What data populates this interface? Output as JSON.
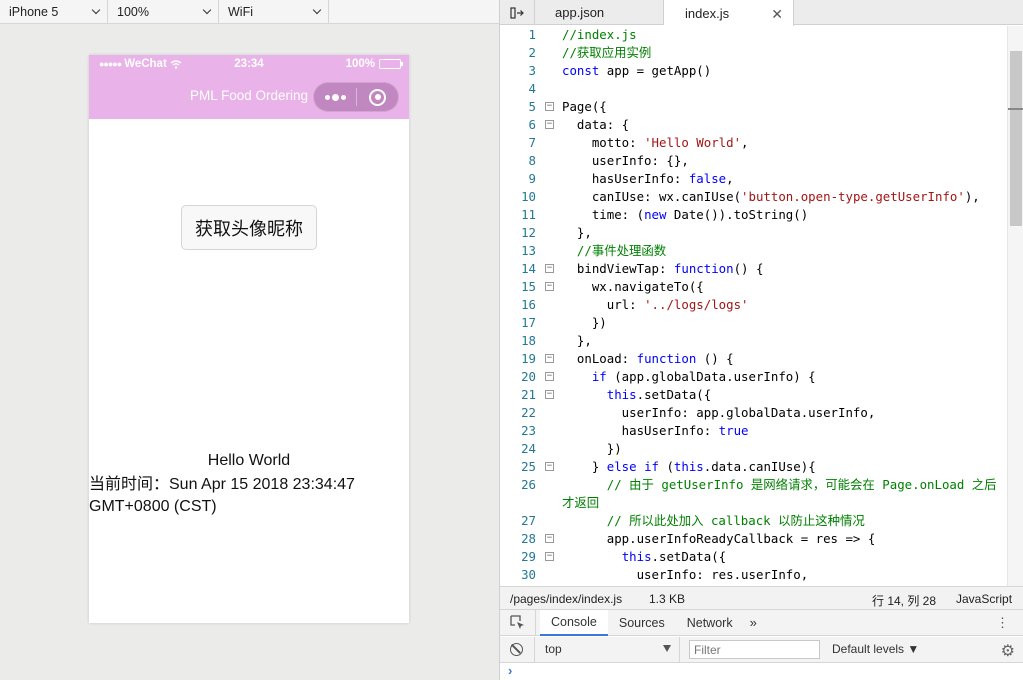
{
  "simulator": {
    "device": "iPhone 5",
    "zoom": "100%",
    "network": "WiFi",
    "status_bar": {
      "carrier": "WeChat",
      "time": "23:34",
      "battery": "100%",
      "battery_level": 1.0
    },
    "nav_title": "PML Food Ordering",
    "get_info_button": "获取头像昵称",
    "motto": "Hello World",
    "time_text": "当前时间：Sun Apr 15 2018 23:34:47 GMT+0800 (CST)",
    "header_color": "#e9b2e8"
  },
  "editor": {
    "tabs": [
      {
        "label": "app.json",
        "active": false
      },
      {
        "label": "index.js",
        "active": true
      }
    ],
    "code_lines": [
      {
        "n": "1",
        "text": "//index.js"
      },
      {
        "n": "2",
        "text": "//获取应用实例"
      },
      {
        "n": "3",
        "text": "const app = getApp()"
      },
      {
        "n": "4",
        "text": ""
      },
      {
        "n": "5",
        "text": "Page({"
      },
      {
        "n": "6",
        "text": "  data: {"
      },
      {
        "n": "7",
        "text": "    motto: 'Hello World',"
      },
      {
        "n": "8",
        "text": "    userInfo: {},"
      },
      {
        "n": "9",
        "text": "    hasUserInfo: false,"
      },
      {
        "n": "10",
        "text": "    canIUse: wx.canIUse('button.open-type.getUserInfo'),"
      },
      {
        "n": "11",
        "text": "    time: (new Date()).toString()"
      },
      {
        "n": "12",
        "text": "  },"
      },
      {
        "n": "13",
        "text": "  //事件处理函数"
      },
      {
        "n": "14",
        "text": "  bindViewTap: function() {"
      },
      {
        "n": "15",
        "text": "    wx.navigateTo({"
      },
      {
        "n": "16",
        "text": "      url: '../logs/logs'"
      },
      {
        "n": "17",
        "text": "    })"
      },
      {
        "n": "18",
        "text": "  },"
      },
      {
        "n": "19",
        "text": "  onLoad: function () {"
      },
      {
        "n": "20",
        "text": "    if (app.globalData.userInfo) {"
      },
      {
        "n": "21",
        "text": "      this.setData({"
      },
      {
        "n": "22",
        "text": "        userInfo: app.globalData.userInfo,"
      },
      {
        "n": "23",
        "text": "        hasUserInfo: true"
      },
      {
        "n": "24",
        "text": "      })"
      },
      {
        "n": "25",
        "text": "    } else if (this.data.canIUse){"
      },
      {
        "n": "26",
        "text": "      // 由于 getUserInfo 是网络请求，可能会在 Page.onLoad 之后才返回"
      },
      {
        "n": "27",
        "text": "      // 所以此处加入 callback 以防止这种情况"
      },
      {
        "n": "28",
        "text": "      app.userInfoReadyCallback = res => {"
      },
      {
        "n": "29",
        "text": "        this.setData({"
      },
      {
        "n": "30",
        "text": "          userInfo: res.userInfo,"
      }
    ],
    "status": {
      "file_path": "/pages/index/index.js",
      "file_size": "1.3 KB",
      "cursor": "行 14, 列 28",
      "language": "JavaScript"
    }
  },
  "devtools": {
    "tabs": [
      "Console",
      "Sources",
      "Network"
    ],
    "more": "»",
    "context": "top",
    "filter_placeholder": "Filter",
    "levels": "Default levels ▼",
    "prompt": "›"
  }
}
